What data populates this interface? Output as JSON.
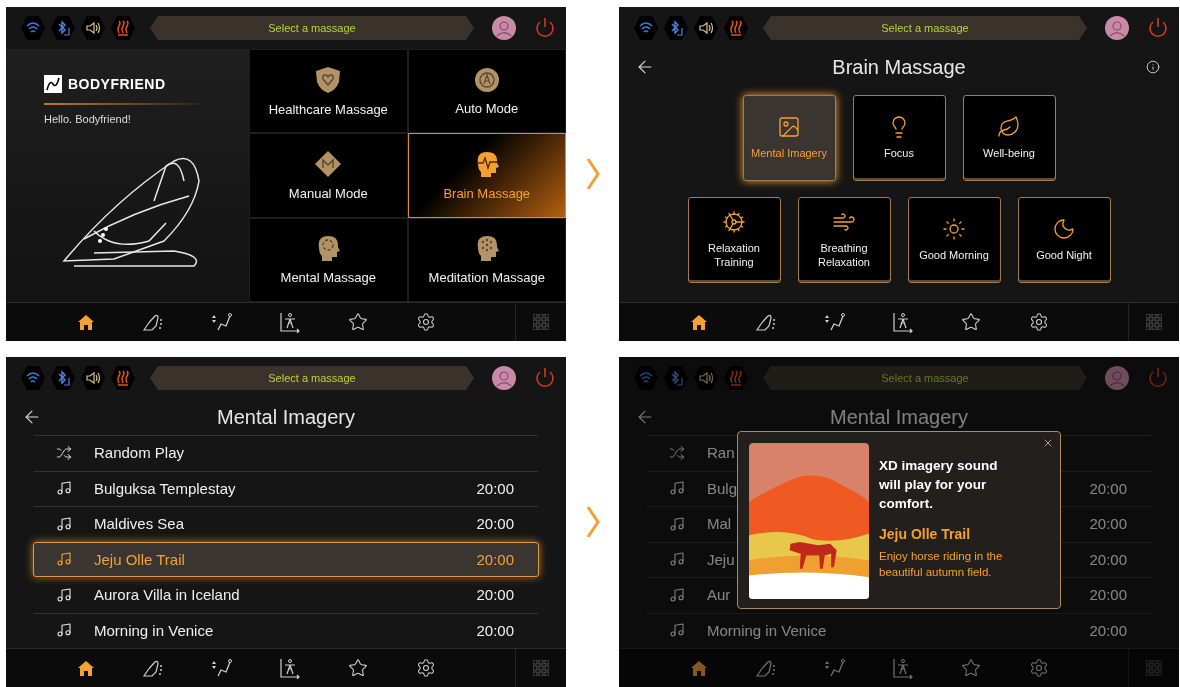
{
  "screens": [
    {
      "kind": "home",
      "dimmed": false,
      "status": "Select a massage",
      "brand": "BODYFRIEND",
      "greeting": "Hello. Bodyfriend!",
      "tiles": [
        {
          "label": "Healthcare Massage",
          "selected": false
        },
        {
          "label": "Auto Mode",
          "selected": false
        },
        {
          "label": "Manual Mode",
          "selected": false
        },
        {
          "label": "Brain Massage",
          "selected": true
        },
        {
          "label": "Mental Massage",
          "selected": false
        },
        {
          "label": "Meditation Massage",
          "selected": false
        }
      ],
      "nav": [
        {
          "selected": true
        },
        {
          "selected": false
        },
        {
          "selected": false
        },
        {
          "selected": false
        },
        {
          "selected": false
        },
        {
          "selected": false
        }
      ]
    },
    {
      "kind": "menu",
      "dimmed": false,
      "status": "Select a massage",
      "title": "Brain Massage",
      "tiles": [
        {
          "label": "Mental Imagery",
          "selected": true
        },
        {
          "label": "Focus",
          "selected": false
        },
        {
          "label": "Well-being",
          "selected": false
        },
        {
          "label": "Relaxation Training",
          "selected": false
        },
        {
          "label": "Breathing Relaxation",
          "selected": false
        },
        {
          "label": "Good Morning",
          "selected": false
        },
        {
          "label": "Good Night",
          "selected": false
        }
      ],
      "nav": [
        {
          "selected": true
        },
        {
          "selected": false
        },
        {
          "selected": false
        },
        {
          "selected": false
        },
        {
          "selected": false
        },
        {
          "selected": false
        }
      ]
    },
    {
      "kind": "list",
      "dimmed": false,
      "status": "Select a massage",
      "title": "Mental Imagery",
      "rows": [
        {
          "kind": "shuffle",
          "name": "Random Play",
          "selected": false
        },
        {
          "kind": "track",
          "name": "Bulguksa Templestay",
          "time": "20:00",
          "selected": false
        },
        {
          "kind": "track",
          "name": "Maldives Sea",
          "time": "20:00",
          "selected": false
        },
        {
          "kind": "track",
          "name": "Jeju Olle Trail",
          "time": "20:00",
          "selected": true
        },
        {
          "kind": "track",
          "name": "Aurora Villa in Iceland",
          "time": "20:00",
          "selected": false
        },
        {
          "kind": "track",
          "name": "Morning in Venice",
          "time": "20:00",
          "selected": false
        }
      ],
      "nav": [
        {
          "selected": true
        },
        {
          "selected": false
        },
        {
          "selected": false
        },
        {
          "selected": false
        },
        {
          "selected": false
        },
        {
          "selected": false
        }
      ]
    },
    {
      "kind": "list",
      "dimmed": true,
      "status": "Select a massage",
      "title": "Mental Imagery",
      "rows": [
        {
          "kind": "shuffle",
          "name": "Ran",
          "selected": false
        },
        {
          "kind": "track",
          "name": "Bulg",
          "time": "20:00",
          "selected": false
        },
        {
          "kind": "track",
          "name": "Mal",
          "time": "20:00",
          "selected": false
        },
        {
          "kind": "track",
          "name": "Jeju",
          "time": "20:00",
          "selected": false
        },
        {
          "kind": "track",
          "name": "Aur",
          "time": "20:00",
          "selected": false
        },
        {
          "kind": "track",
          "name": "Morning in Venice",
          "time": "20:00",
          "selected": false
        }
      ],
      "popup": {
        "message": "XD imagery sound will play for your comfort.",
        "title": "Jeju Olle Trail",
        "description": "Enjoy horse riding in the beautiful autumn field."
      },
      "nav": [
        {
          "selected": true
        },
        {
          "selected": false
        },
        {
          "selected": false
        },
        {
          "selected": false
        },
        {
          "selected": false
        },
        {
          "selected": false
        }
      ]
    }
  ]
}
